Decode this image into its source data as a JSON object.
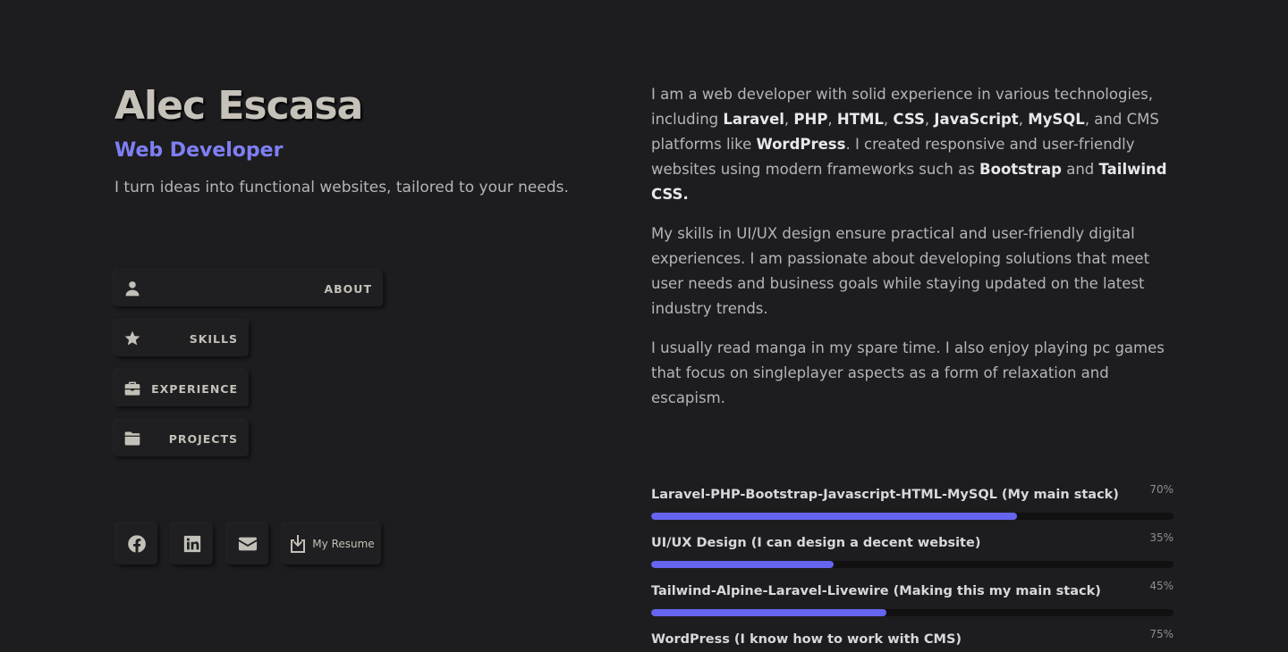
{
  "profile": {
    "name": "Alec Escasa",
    "role": "Web Developer",
    "tagline": "I turn ideas into functional websites, tailored to your needs."
  },
  "nav": {
    "items": [
      {
        "label": "ABOUT",
        "icon": "user-icon"
      },
      {
        "label": "SKILLS",
        "icon": "star-icon"
      },
      {
        "label": "EXPERIENCE",
        "icon": "briefcase-icon"
      },
      {
        "label": "PROJECTS",
        "icon": "folder-icon"
      }
    ]
  },
  "social": {
    "facebook_icon": "facebook-icon",
    "linkedin_icon": "linkedin-icon",
    "email_icon": "mail-icon",
    "resume_label": "My Resume",
    "resume_icon": "download-icon"
  },
  "about": {
    "p1": {
      "t0": "I am a web developer with solid experience in various technologies, including ",
      "b0": "Laravel",
      "t1": ", ",
      "b1": "PHP",
      "t2": ", ",
      "b2": "HTML",
      "t3": ", ",
      "b3": "CSS",
      "t4": ", ",
      "b4": "JavaScript",
      "t5": ", ",
      "b5": "MySQL",
      "t6": ", and CMS platforms like ",
      "b6": "WordPress",
      "t7": ". I created responsive and user-friendly websites using modern frameworks such as ",
      "b7": "Bootstrap",
      "t8": " and ",
      "b8": "Tailwind CSS."
    },
    "p2": "My skills in UI/UX design ensure practical and user-friendly digital experiences. I am passionate about developing solutions that meet user needs and business goals while staying updated on the latest industry trends.",
    "p3": "I usually read manga in my spare time. I also enjoy playing pc games that focus on singleplayer aspects as a form of relaxation and escapism."
  },
  "skills": [
    {
      "name": "Laravel-PHP-Bootstrap-Javascript-HTML-MySQL (My main stack)",
      "percent_label": "70%",
      "percent": 70
    },
    {
      "name": "UI/UX Design (I can design a decent website)",
      "percent_label": "35%",
      "percent": 35
    },
    {
      "name": "Tailwind-Alpine-Laravel-Livewire (Making this my main stack)",
      "percent_label": "45%",
      "percent": 45
    },
    {
      "name": "WordPress (I know how to work with CMS)",
      "percent_label": "75%",
      "percent": 75
    }
  ],
  "colors": {
    "background": "#1d1d1f",
    "accent": "#7f7ff5",
    "bar_fill": "#6565f0",
    "bar_track": "#111112"
  }
}
